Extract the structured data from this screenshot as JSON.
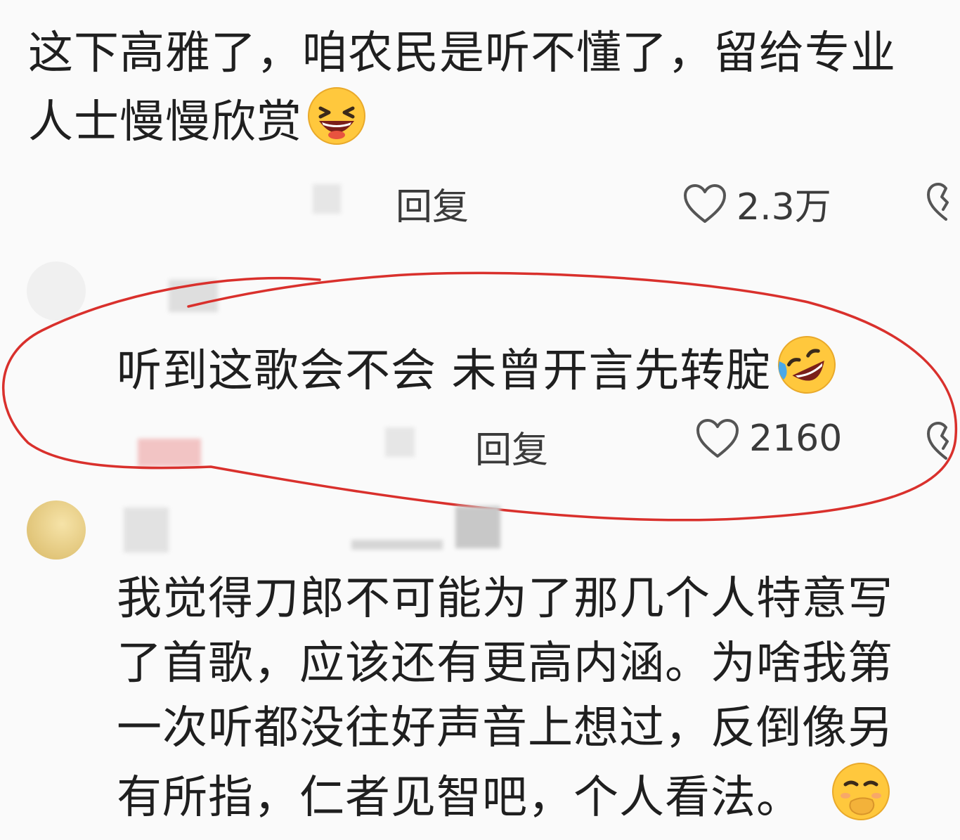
{
  "comments": [
    {
      "text_lines": [
        "这下高雅了，咱农民是听不懂了，留给专业",
        "人士慢慢欣赏"
      ],
      "emoji": "laughing-face",
      "reply_label": "回复",
      "likes": "2.3万"
    },
    {
      "text_lines": [
        "听到这歌会不会 未曾开言先转腚"
      ],
      "emoji": "rofl-face",
      "reply_label": "回复",
      "likes": "2160",
      "highlighted": true
    },
    {
      "text_lines": [
        "我觉得刀郎不可能为了那几个人特意写",
        "了首歌，应该还有更高内涵。为啥我第",
        "一次听都没往好声音上想过，反倒像另",
        "有所指，仁者见智吧，个人看法。"
      ],
      "emoji": "hand-over-mouth-face"
    }
  ],
  "colors": {
    "background": "#fafafa",
    "text": "#1f1f1f",
    "meta": "#3a3a3a",
    "highlight_ring": "#d9302c",
    "emoji_yellow": "#ffc83d"
  }
}
